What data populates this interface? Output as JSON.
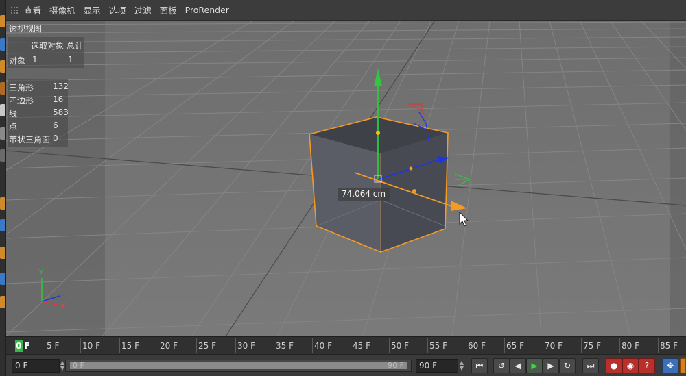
{
  "menubar": {
    "items": [
      "查看",
      "摄像机",
      "显示",
      "选项",
      "过滤",
      "面板",
      "ProRender"
    ]
  },
  "viewport": {
    "title": "透视视图",
    "stats": {
      "col_selected": "选取对象",
      "col_total": "总计",
      "object_label": "对象",
      "object_selected": "1",
      "object_total": "1",
      "rows": [
        {
          "label": "三角形",
          "value": "132"
        },
        {
          "label": "四边形",
          "value": "16"
        },
        {
          "label": "线",
          "value": "583"
        },
        {
          "label": "点",
          "value": "6"
        },
        {
          "label": "带状三角面",
          "value": "0"
        }
      ]
    },
    "distance_label": "74.064 cm",
    "axis_labels": {
      "y": "Y",
      "z": "Z",
      "x": "X"
    },
    "colors": {
      "selection": "#f59a23",
      "x_axis": "#f59a23",
      "y_axis": "#2fc73b",
      "z_axis": "#2234e0"
    }
  },
  "timeline": {
    "current": "0 F",
    "labels": [
      "5 F",
      "10 F",
      "15 F",
      "20 F",
      "25 F",
      "30 F",
      "35 F",
      "40 F",
      "45 F",
      "50 F",
      "55 F",
      "60 F",
      "65 F",
      "70 F",
      "75 F",
      "80 F",
      "85 F"
    ]
  },
  "transport": {
    "current_frame": "0 F",
    "range_start": "0 F",
    "range_end": "90 F",
    "end_frame": "90 F",
    "buttons": {
      "go_start": "go-to-start-icon",
      "prev_key": "previous-key-icon",
      "prev_frame": "previous-frame-icon",
      "play": "play-icon",
      "next_frame": "next-frame-icon",
      "next_key": "next-key-icon",
      "go_end": "go-to-end-icon",
      "record": "record-icon",
      "autokey": "autokey-icon",
      "keyframe_help": "keyframe-help-icon",
      "move": "move-icon"
    }
  }
}
